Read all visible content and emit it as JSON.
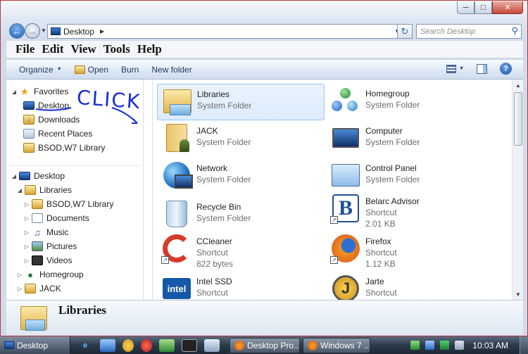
{
  "window": {
    "address_path": "Desktop",
    "search_placeholder": "Search Desktop"
  },
  "menubar": [
    "File",
    "Edit",
    "View",
    "Tools",
    "Help"
  ],
  "commandbar": {
    "organize": "Organize",
    "open": "Open",
    "burn": "Burn",
    "new_folder": "New folder"
  },
  "navpane": {
    "favorites": {
      "header": "Favorites",
      "items": [
        "Desktop",
        "Downloads",
        "Recent Places",
        "BSOD,W7 Library"
      ]
    },
    "tree": {
      "root": "Desktop",
      "libraries": "Libraries",
      "library_items": [
        "BSOD,W7 Library",
        "Documents",
        "Music",
        "Pictures",
        "Videos"
      ],
      "homegroup": "Homegroup",
      "user": "JACK"
    },
    "annotation": "CLICK"
  },
  "files": [
    {
      "name": "Libraries",
      "sub1": "System Folder",
      "sub2": "",
      "icon": "libraries-icon",
      "selected": true
    },
    {
      "name": "Homegroup",
      "sub1": "System Folder",
      "sub2": "",
      "icon": "homegroup-icon"
    },
    {
      "name": "JACK",
      "sub1": "System Folder",
      "sub2": "",
      "icon": "user-folder-icon"
    },
    {
      "name": "Computer",
      "sub1": "System Folder",
      "sub2": "",
      "icon": "computer-icon"
    },
    {
      "name": "Network",
      "sub1": "System Folder",
      "sub2": "",
      "icon": "network-icon"
    },
    {
      "name": "Control Panel",
      "sub1": "System Folder",
      "sub2": "",
      "icon": "control-panel-icon"
    },
    {
      "name": "Recycle Bin",
      "sub1": "System Folder",
      "sub2": "",
      "icon": "recycle-bin-icon"
    },
    {
      "name": "Belarc Advisor",
      "sub1": "Shortcut",
      "sub2": "2.01 KB",
      "icon": "belarc-icon"
    },
    {
      "name": "CCleaner",
      "sub1": "Shortcut",
      "sub2": "822 bytes",
      "icon": "ccleaner-icon"
    },
    {
      "name": "Firefox",
      "sub1": "Shortcut",
      "sub2": "1.12 KB",
      "icon": "firefox-icon"
    },
    {
      "name": "Intel SSD",
      "sub1": "Shortcut",
      "sub2": "",
      "icon": "intel-icon"
    },
    {
      "name": "Jarte",
      "sub1": "Shortcut",
      "sub2": "",
      "icon": "jarte-icon"
    }
  ],
  "details": {
    "name": "Libraries"
  },
  "taskbar": {
    "start_label": "Desktop",
    "tasks": [
      "Desktop Pro...",
      "Windows 7 ..."
    ],
    "clock": "10:03 AM"
  }
}
